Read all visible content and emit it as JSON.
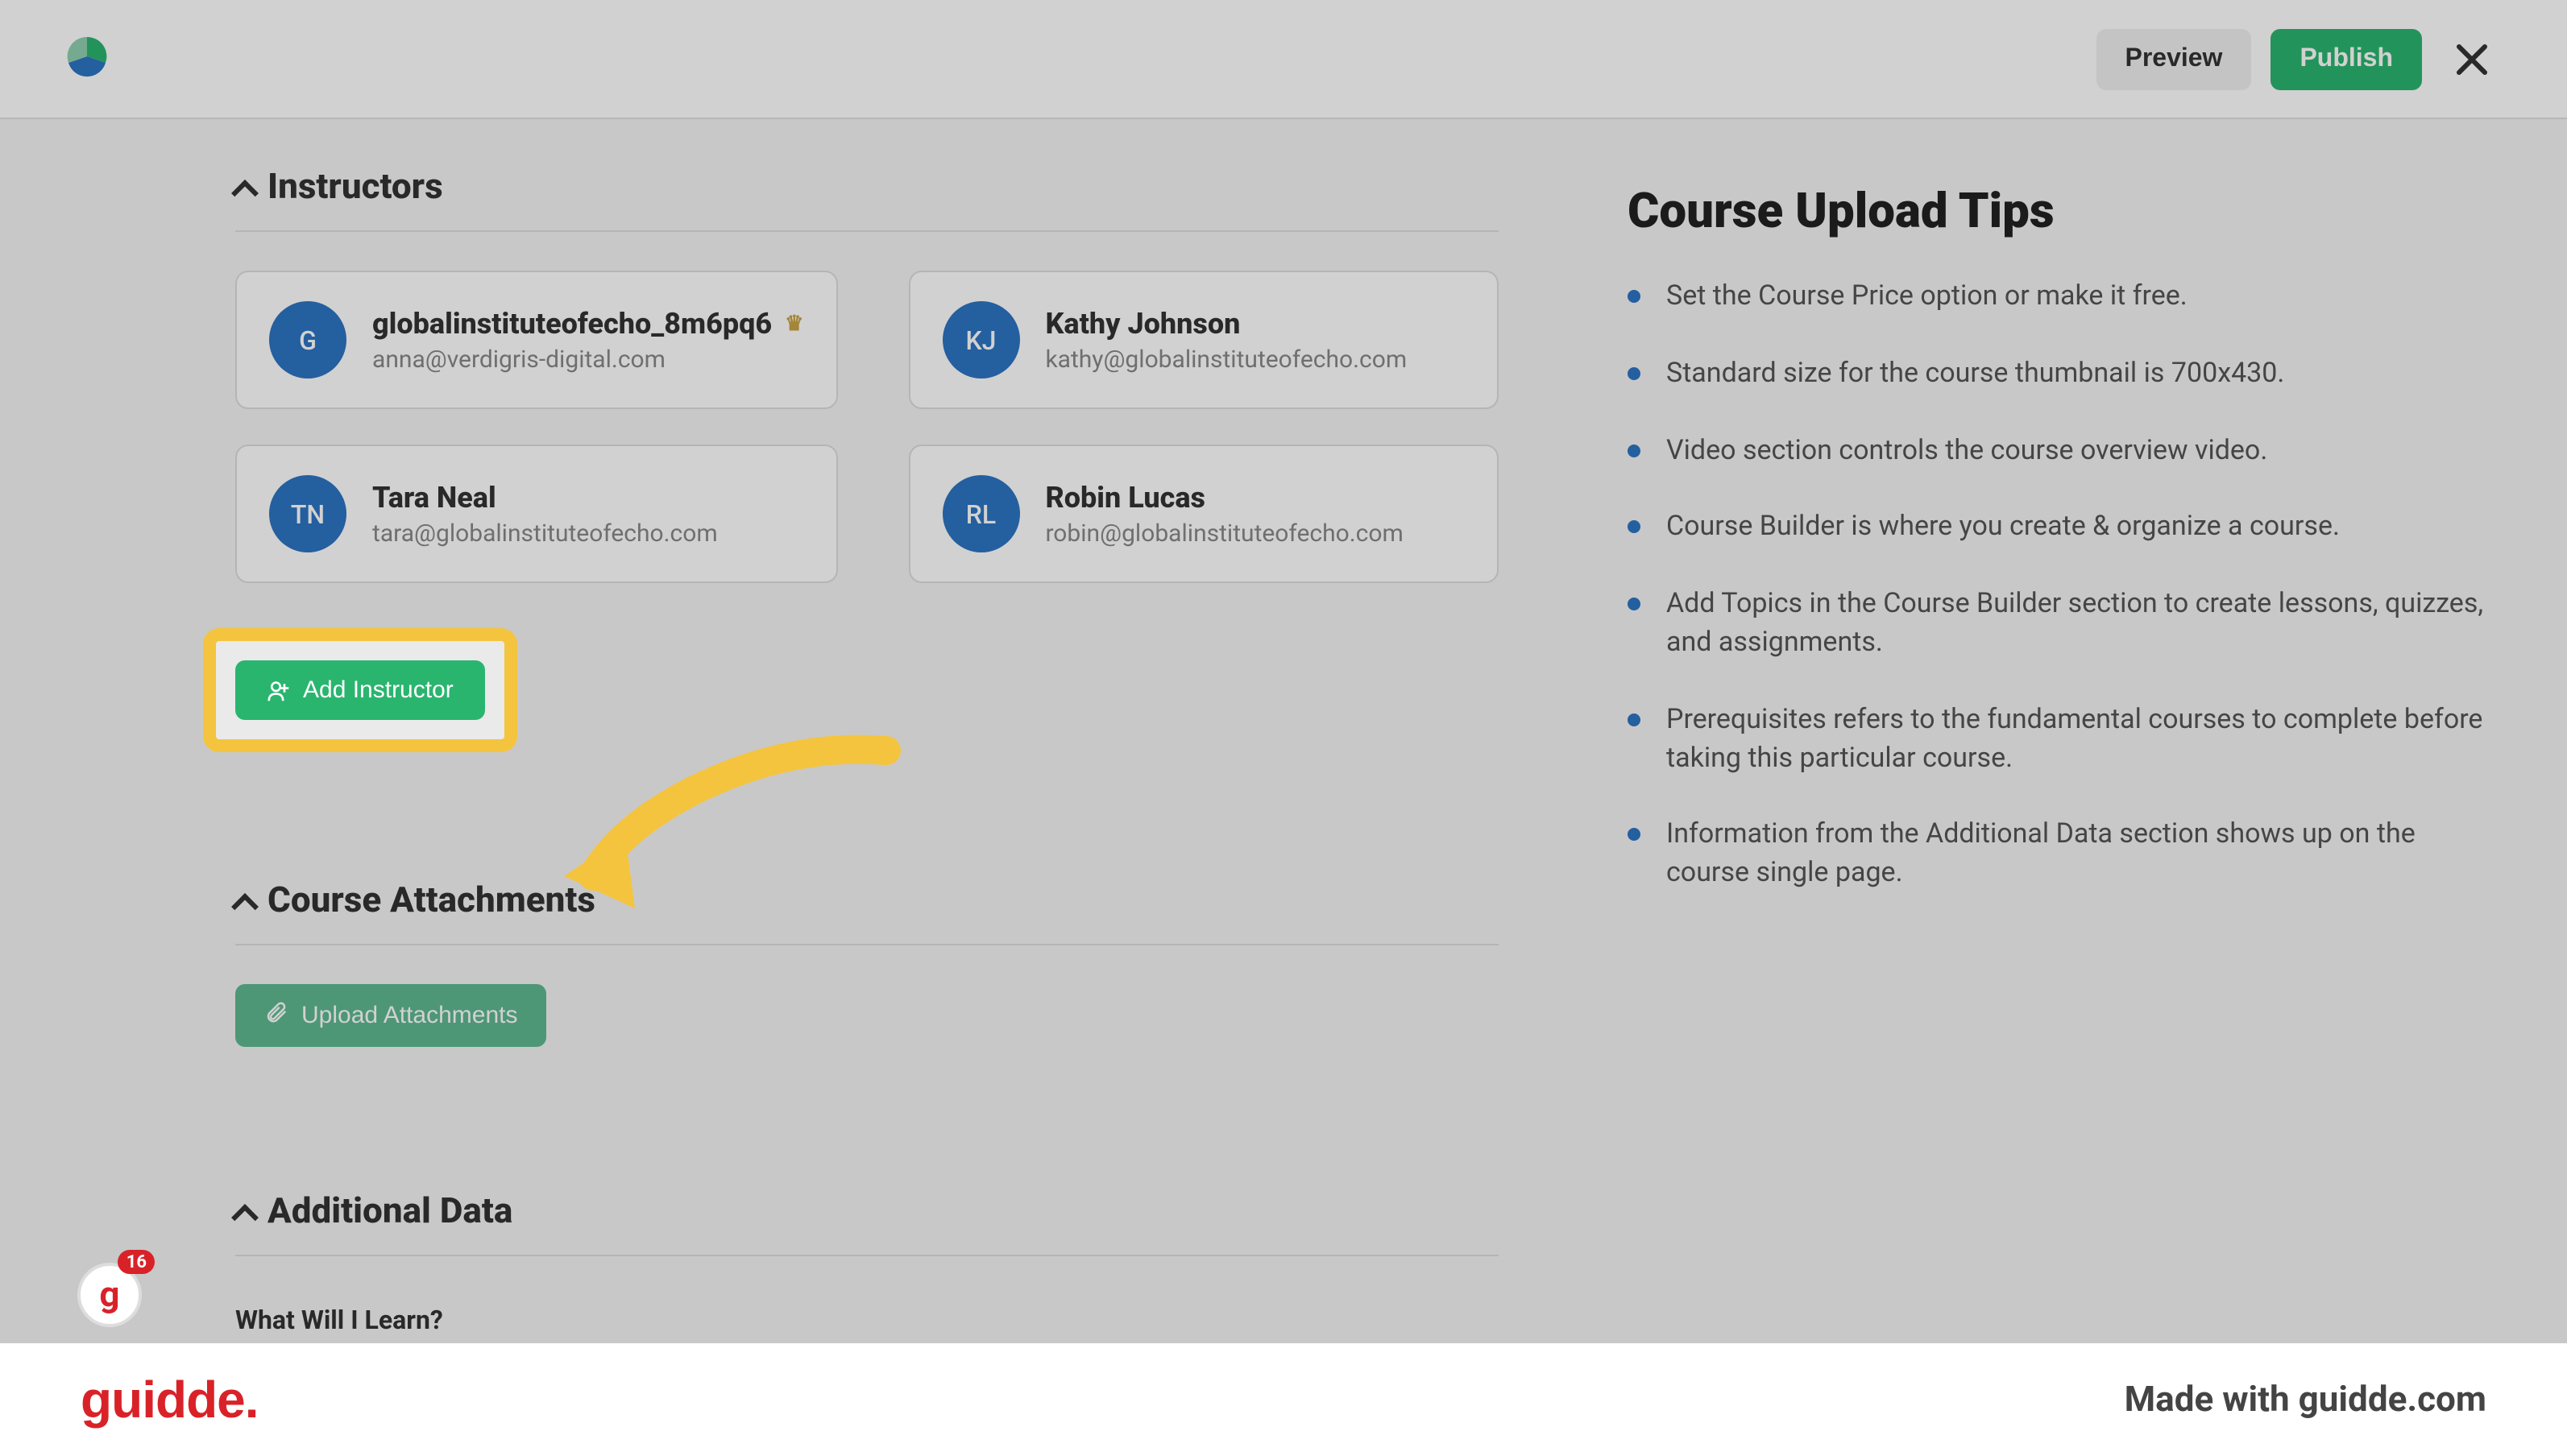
{
  "header": {
    "preview_label": "Preview",
    "publish_label": "Publish"
  },
  "sections": {
    "instructors_title": "Instructors",
    "attachments_title": "Course Attachments",
    "additional_title": "Additional Data"
  },
  "instructors": [
    {
      "initials": "G",
      "name": "globalinstituteofecho_8m6pq6",
      "email": "anna@verdigris-digital.com",
      "owner": true
    },
    {
      "initials": "KJ",
      "name": "Kathy Johnson",
      "email": "kathy@globalinstituteofecho.com",
      "owner": false
    },
    {
      "initials": "TN",
      "name": "Tara Neal",
      "email": "tara@globalinstituteofecho.com",
      "owner": false
    },
    {
      "initials": "RL",
      "name": "Robin Lucas",
      "email": "robin@globalinstituteofecho.com",
      "owner": false
    }
  ],
  "buttons": {
    "add_instructor": "Add Instructor",
    "upload_attachments": "Upload Attachments"
  },
  "additional": {
    "what_learn_label": "What Will I Learn?"
  },
  "tips": {
    "title": "Course Upload Tips",
    "items": [
      "Set the Course Price option or make it free.",
      "Standard size for the course thumbnail is 700x430.",
      "Video section controls the course overview video.",
      "Course Builder is where you create & organize a course.",
      "Add Topics in the Course Builder section to create lessons, quizzes, and assignments.",
      "Prerequisites refers to the fundamental courses to complete before taking this particular course.",
      "Information from the Additional Data section shows up on the course single page."
    ]
  },
  "footer": {
    "brand": "guidde.",
    "made_with": "Made with guidde.com"
  },
  "badge": {
    "glyph": "g",
    "count": "16"
  }
}
